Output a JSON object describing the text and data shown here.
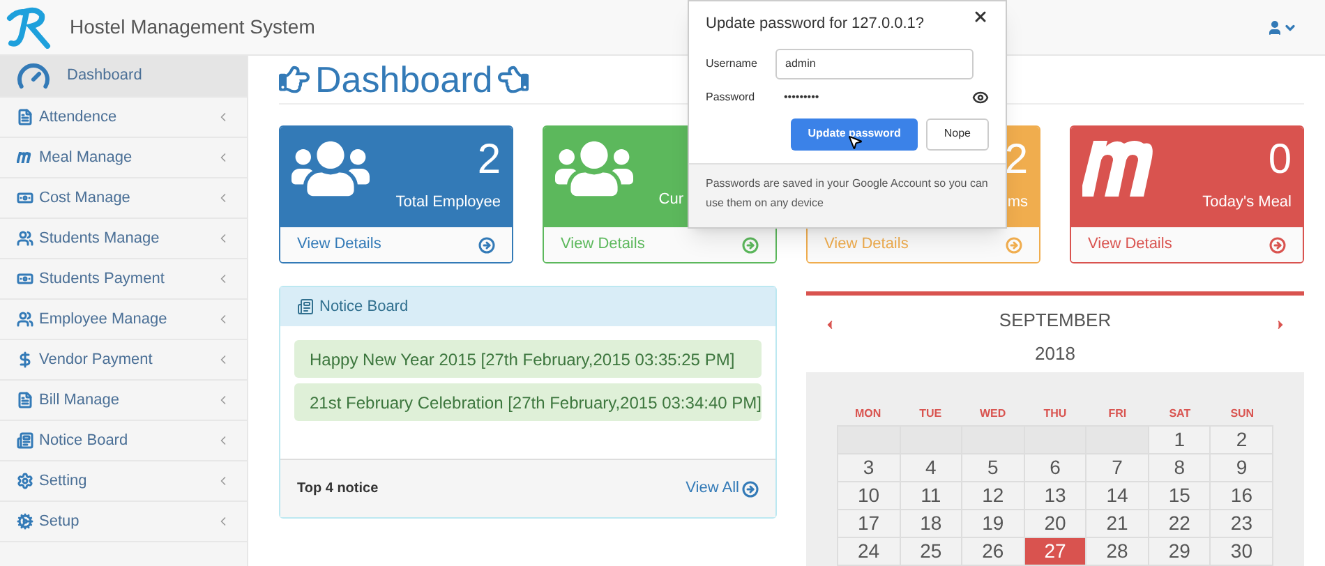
{
  "header": {
    "title": "Hostel Management System"
  },
  "sidebar": {
    "items": [
      {
        "label": "Dashboard",
        "kind": "gauge",
        "selected": true
      },
      {
        "label": "Attendence",
        "kind": "file",
        "selected": false
      },
      {
        "label": "Meal Manage",
        "kind": "meal",
        "selected": false
      },
      {
        "label": "Cost Manage",
        "kind": "money",
        "selected": false
      },
      {
        "label": "Students Manage",
        "kind": "users",
        "selected": false
      },
      {
        "label": "Students Payment",
        "kind": "money",
        "selected": false
      },
      {
        "label": "Employee Manage",
        "kind": "users",
        "selected": false
      },
      {
        "label": "Vendor Payment",
        "kind": "dollar",
        "selected": false
      },
      {
        "label": "Bill Manage",
        "kind": "file",
        "selected": false
      },
      {
        "label": "Notice Board",
        "kind": "list",
        "selected": false
      },
      {
        "label": "Setting",
        "kind": "gear",
        "selected": false
      },
      {
        "label": "Setup",
        "kind": "gears",
        "selected": false
      }
    ]
  },
  "page_title": "Dashboard",
  "cards": [
    {
      "kind": "users",
      "color": "#337ab7",
      "value": "2",
      "label": "Total Employee",
      "link": "View Details",
      "clipped": false
    },
    {
      "kind": "users",
      "color": "#5cb85c",
      "label": "Cur",
      "link": "View Details",
      "clipped": true
    },
    {
      "kind": "plain",
      "color": "#f0ad4e",
      "value": "2",
      "label": "ms",
      "link": "View Details",
      "clipped": false
    },
    {
      "kind": "meal",
      "color": "#d9534f",
      "value": "0",
      "label": "Today's Meal",
      "link": "View Details",
      "clipped": false
    }
  ],
  "notice_board": {
    "title": "Notice Board",
    "notices": [
      "Happy New Year 2015 [27th February,2015 03:35:25 PM]",
      "21st February Celebration [27th February,2015 03:34:40 PM]"
    ],
    "footer": "Top 4 notice",
    "view_all": "View All"
  },
  "calendar": {
    "month": "SEPTEMBER",
    "year": "2018",
    "weekdays": [
      "MON",
      "TUE",
      "WED",
      "THU",
      "FRI",
      "SAT",
      "SUN"
    ],
    "weeks": [
      [
        {
          "kind": "empty"
        },
        {
          "kind": "empty"
        },
        {
          "kind": "empty"
        },
        {
          "kind": "empty"
        },
        {
          "kind": "empty"
        },
        {
          "kind": "day",
          "day": "1",
          "selected": false
        },
        {
          "kind": "day",
          "day": "2",
          "selected": false
        }
      ],
      [
        {
          "kind": "day",
          "day": "3",
          "selected": false
        },
        {
          "kind": "day",
          "day": "4",
          "selected": false
        },
        {
          "kind": "day",
          "day": "5",
          "selected": false
        },
        {
          "kind": "day",
          "day": "6",
          "selected": false
        },
        {
          "kind": "day",
          "day": "7",
          "selected": false
        },
        {
          "kind": "day",
          "day": "8",
          "selected": false
        },
        {
          "kind": "day",
          "day": "9",
          "selected": false
        }
      ],
      [
        {
          "kind": "day",
          "day": "10",
          "selected": false
        },
        {
          "kind": "day",
          "day": "11",
          "selected": false
        },
        {
          "kind": "day",
          "day": "12",
          "selected": false
        },
        {
          "kind": "day",
          "day": "13",
          "selected": false
        },
        {
          "kind": "day",
          "day": "14",
          "selected": false
        },
        {
          "kind": "day",
          "day": "15",
          "selected": false
        },
        {
          "kind": "day",
          "day": "16",
          "selected": false
        }
      ],
      [
        {
          "kind": "day",
          "day": "17",
          "selected": false
        },
        {
          "kind": "day",
          "day": "18",
          "selected": false
        },
        {
          "kind": "day",
          "day": "19",
          "selected": false
        },
        {
          "kind": "day",
          "day": "20",
          "selected": false
        },
        {
          "kind": "day",
          "day": "21",
          "selected": false
        },
        {
          "kind": "day",
          "day": "22",
          "selected": false
        },
        {
          "kind": "day",
          "day": "23",
          "selected": false
        }
      ],
      [
        {
          "kind": "day",
          "day": "24",
          "selected": false
        },
        {
          "kind": "day",
          "day": "25",
          "selected": false
        },
        {
          "kind": "day",
          "day": "26",
          "selected": false
        },
        {
          "kind": "day",
          "day": "27",
          "selected": true
        },
        {
          "kind": "day",
          "day": "28",
          "selected": false
        },
        {
          "kind": "day",
          "day": "29",
          "selected": false
        },
        {
          "kind": "day",
          "day": "30",
          "selected": false
        }
      ]
    ]
  },
  "password_popup": {
    "title": "Update password for 127.0.0.1?",
    "username_label": "Username",
    "username": "admin",
    "password_label": "Password",
    "password": "•••••••••",
    "primary_button": "Update password",
    "secondary_button": "Nope",
    "footer": "Passwords are saved in your Google Account so you can use them on any device"
  }
}
